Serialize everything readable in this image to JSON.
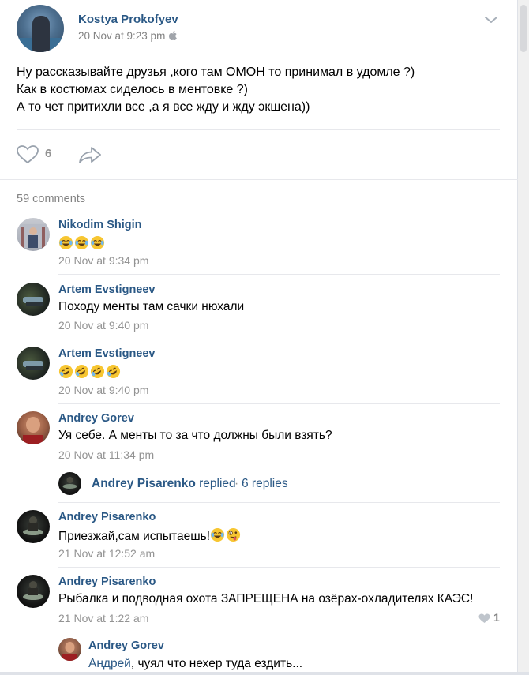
{
  "post": {
    "author": "Kostya Prokofyev",
    "date": "20 Nov at 9:23 pm",
    "lines": [
      "Ну рассказывайте друзья ,кого там ОМОН то принимал в удомле ?)",
      "Как в костюмах сиделось в ментовке ?)",
      "А то чет притихли все ,а я все жду и жду экшена))"
    ],
    "likes": "6"
  },
  "comments_count": "59 comments",
  "comments": [
    {
      "author": "Nikodim Shigin",
      "text": "",
      "date": "20 Nov at 9:34 pm"
    },
    {
      "author": "Artem Evstigneev",
      "text": "Походу менты там сачки нюхали",
      "date": "20 Nov at 9:40 pm"
    },
    {
      "author": "Artem Evstigneev",
      "text": "",
      "date": "20 Nov at 9:40 pm"
    },
    {
      "author": "Andrey Gorev",
      "text": "Уя себе. А менты то за что должны были взять?",
      "date": "20 Nov at 11:34 pm"
    },
    {
      "author": "Andrey Pisarenko",
      "text": "Приезжай,сам испытаешь!",
      "date": "21 Nov at 12:52 am"
    },
    {
      "author": "Andrey Pisarenko",
      "text": "Рыбалка и подводная охота ЗАПРЕЩЕНА на озёрах-охладителях КАЭС!",
      "date": "21 Nov at 1:22 am",
      "likes": "1"
    }
  ],
  "replied": {
    "name": "Andrey Pisarenko",
    "word": "replied",
    "sep": "·",
    "count": "6 replies"
  },
  "nested_reply": {
    "author": "Andrey Gorev",
    "mention": "Андрей",
    "text": ", чуял что нехер туда ездить..."
  },
  "colors": {
    "link": "#2a5885",
    "meta": "#939393",
    "divider": "#e7e8ec"
  },
  "icons": [
    "apple-icon",
    "chevron-down-icon",
    "heart-icon",
    "share-icon",
    "emoji-joy",
    "emoji-rofl",
    "emoji-goofy"
  ]
}
